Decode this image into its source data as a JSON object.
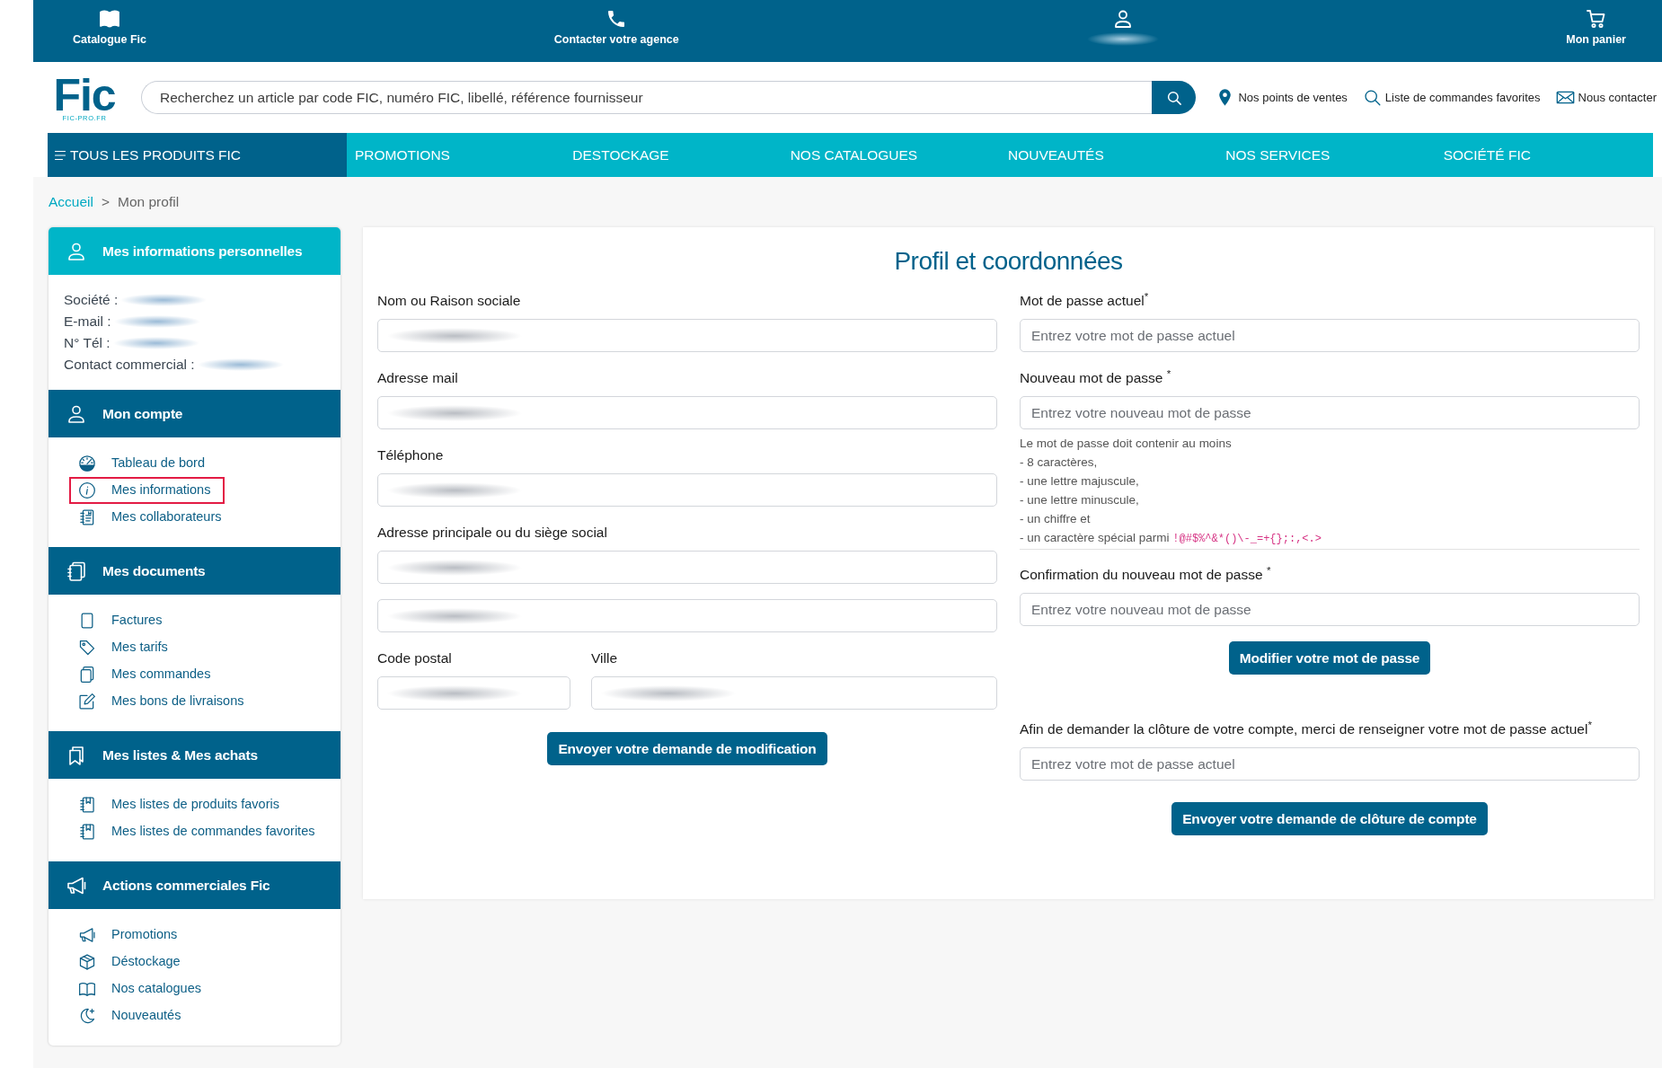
{
  "top_bar": {
    "items": [
      {
        "label": "Catalogue Fic"
      },
      {
        "label": "Contacter votre agence"
      },
      {
        "blurred": true
      },
      {
        "label": "Mon panier"
      }
    ]
  },
  "header": {
    "logo": {
      "text": "Fic",
      "tagline": "FIC-PRO.FR"
    },
    "search": {
      "placeholder": "Recherchez un article par code FIC, numéro FIC, libellé, référence fournisseur"
    },
    "links": [
      {
        "label": "Nos points de ventes"
      },
      {
        "label": "Liste de commandes favorites"
      },
      {
        "label": "Nous contacter"
      }
    ]
  },
  "nav": {
    "all_products": "TOUS LES PRODUITS FIC",
    "items": [
      "PROMOTIONS",
      "DESTOCKAGE",
      "NOS CATALOGUES",
      "NOUVEAUTÉS",
      "NOS SERVICES",
      "SOCIÉTÉ FIC"
    ]
  },
  "breadcrumb": [
    {
      "label": "Accueil",
      "kind": "link"
    },
    {
      "label": ">",
      "kind": "separator"
    },
    {
      "label": "Mon profil",
      "kind": "current"
    }
  ],
  "sidebar": {
    "sections": [
      {
        "title": "Mes informations personnelles",
        "highlighted": true,
        "info": [
          {
            "label": "Société :",
            "blurred": true
          },
          {
            "label": "E-mail :",
            "blurred": true
          },
          {
            "label": "N° Tél :",
            "blurred": true
          },
          {
            "label": "Contact commercial :",
            "blurred": true
          }
        ]
      },
      {
        "title": "Mon compte",
        "highlighted": false,
        "items": [
          {
            "label": "Tableau de bord",
            "selected": false
          },
          {
            "label": "Mes informations",
            "selected": true
          },
          {
            "label": "Mes collaborateurs",
            "selected": false
          }
        ]
      },
      {
        "title": "Mes documents",
        "highlighted": false,
        "items": [
          {
            "label": "Factures",
            "selected": false
          },
          {
            "label": "Mes tarifs",
            "selected": false
          },
          {
            "label": "Mes commandes",
            "selected": false
          },
          {
            "label": "Mes bons de livraisons",
            "selected": false
          }
        ]
      },
      {
        "title": "Mes listes & Mes achats",
        "highlighted": false,
        "items": [
          {
            "label": "Mes listes de produits favoris",
            "selected": false
          },
          {
            "label": "Mes listes de commandes favorites",
            "selected": false
          }
        ]
      },
      {
        "title": "Actions commerciales Fic",
        "highlighted": false,
        "items": [
          {
            "label": "Promotions",
            "selected": false
          },
          {
            "label": "Déstockage",
            "selected": false
          },
          {
            "label": "Nos catalogues",
            "selected": false
          },
          {
            "label": "Nouveautés",
            "selected": false
          }
        ]
      }
    ]
  },
  "profile": {
    "title": "Profil et coordonnées",
    "fields": [
      {
        "label": "Nom ou Raison sociale",
        "blurred": true
      },
      {
        "label": "Adresse mail",
        "blurred": true
      },
      {
        "label": "Téléphone",
        "blurred": true
      },
      {
        "label": "Adresse principale ou du siège social",
        "blurred": true,
        "extra_line": {
          "blurred": true
        }
      }
    ],
    "location": [
      {
        "label": "Code postal",
        "blurred": true
      },
      {
        "label": "Ville",
        "blurred": true
      }
    ],
    "button": "Envoyer votre demande de modification"
  },
  "password": {
    "fields": [
      {
        "label": "Mot de passe actuel$^{*}$",
        "placeholder": "Entrez votre mot de passe actuel"
      },
      {
        "label": "Nouveau mot de passe $^{*}$",
        "placeholder": "Entrez votre nouveau mot de passe",
        "hint": {
          "lines": [
            "Le mot de passe doit contenir au moins",
            "- 8 caractères,",
            "- une lettre majuscule,",
            "- une lettre minuscule,",
            "- un chiffre et",
            "- un caractère spécial parmi"
          ],
          "special_chars": "!@#$%^&*()\\-_=+{};:,<.>"
        }
      },
      {
        "label": "Confirmation du nouveau mot de passe $^{*}$",
        "placeholder": "Entrez votre nouveau mot de passe"
      }
    ],
    "button": "Modifier votre mot de passe"
  },
  "close_account": {
    "label": "Afin de demander la clôture de votre compte, merci de renseigner votre mot de passe actuel$^{*}$",
    "placeholder": "Entrez votre mot de passe actuel",
    "button": "Envoyer votre demande de clôture de compte"
  }
}
